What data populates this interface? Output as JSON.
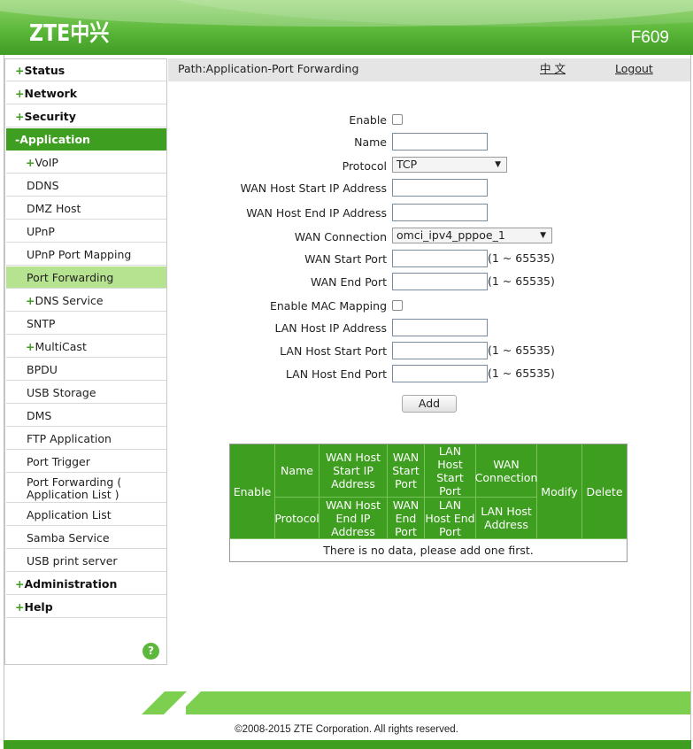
{
  "header": {
    "logo": "ZTE中兴",
    "model": "F609"
  },
  "pathbar": {
    "path": "Path:Application-Port Forwarding",
    "language": "中 文",
    "logout": "Logout"
  },
  "sidebar": {
    "items": [
      {
        "label": "Status",
        "prefix": "+"
      },
      {
        "label": "Network",
        "prefix": "+"
      },
      {
        "label": "Security",
        "prefix": "+"
      },
      {
        "label": "Application",
        "prefix": "-"
      },
      {
        "label": "VoIP",
        "prefix": "+"
      },
      {
        "label": "DDNS"
      },
      {
        "label": "DMZ Host"
      },
      {
        "label": "UPnP"
      },
      {
        "label": "UPnP Port Mapping"
      },
      {
        "label": "Port Forwarding"
      },
      {
        "label": "DNS Service",
        "prefix": "+"
      },
      {
        "label": "SNTP"
      },
      {
        "label": "MultiCast",
        "prefix": "+"
      },
      {
        "label": "BPDU"
      },
      {
        "label": "USB Storage"
      },
      {
        "label": "DMS"
      },
      {
        "label": "FTP Application"
      },
      {
        "label": "Port Trigger"
      },
      {
        "label": "Port Forwarding (",
        "label2": "Application List )"
      },
      {
        "label": "Application List"
      },
      {
        "label": "Samba Service"
      },
      {
        "label": "USB print server"
      },
      {
        "label": "Administration",
        "prefix": "+"
      },
      {
        "label": "Help",
        "prefix": "+"
      }
    ],
    "help_icon": "?"
  },
  "form": {
    "enable_label": "Enable",
    "name_label": "Name",
    "name_value": "",
    "protocol_label": "Protocol",
    "protocol_value": "TCP",
    "wan_host_start_ip_label": "WAN Host Start IP Address",
    "wan_host_start_ip_value": "",
    "wan_host_end_ip_label": "WAN Host End IP Address",
    "wan_host_end_ip_value": "",
    "wan_connection_label": "WAN Connection",
    "wan_connection_value": "omci_ipv4_pppoe_1",
    "wan_start_port_label": "WAN Start Port",
    "wan_start_port_value": "",
    "wan_start_port_hint": "(1 ~ 65535)",
    "wan_end_port_label": "WAN End Port",
    "wan_end_port_value": "",
    "wan_end_port_hint": "(1 ~ 65535)",
    "enable_mac_label": "Enable MAC Mapping",
    "lan_host_ip_label": "LAN Host IP Address",
    "lan_host_ip_value": "",
    "lan_host_start_port_label": "LAN Host Start Port",
    "lan_host_start_port_value": "",
    "lan_host_start_port_hint": "(1 ~ 65535)",
    "lan_host_end_port_label": "LAN Host End Port",
    "lan_host_end_port_value": "",
    "lan_host_end_port_hint": "(1 ~ 65535)",
    "add_button": "Add"
  },
  "table": {
    "headers": {
      "enable": "Enable",
      "name": "Name",
      "wan_host_start_ip": "WAN Host Start IP Address",
      "wan_start_port": "WAN Start Port",
      "lan_host_start_port": "LAN Host Start Port",
      "wan_connection": "WAN Connection",
      "modify": "Modify",
      "delete": "Delete",
      "protocol": "Protocol",
      "wan_host_end_ip": "WAN Host End IP Address",
      "wan_end_port": "WAN End Port",
      "lan_host_end_port": "LAN Host End Port",
      "lan_host_address": "LAN Host Address"
    },
    "empty_message": "There is no data, please add one first."
  },
  "footer": {
    "copyright": "©2008-2015 ZTE Corporation. All rights reserved."
  }
}
